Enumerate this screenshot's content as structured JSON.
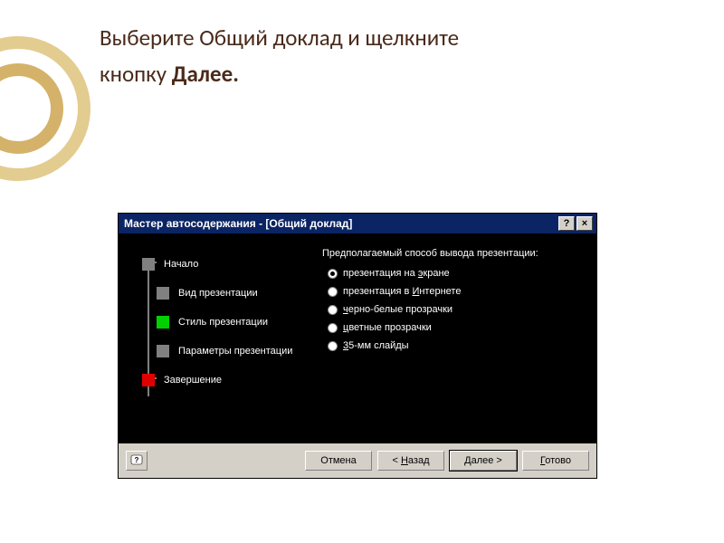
{
  "instruction": {
    "line1": "Выберите Общий доклад и щелкните",
    "line2_prefix": "кнопку ",
    "line2_bold": "Далее."
  },
  "dialog": {
    "title": "Мастер автосодержания - [Общий доклад]",
    "steps": [
      {
        "label": "Начало",
        "color": "gray",
        "offset": false
      },
      {
        "label": "Вид презентации",
        "color": "gray",
        "offset": true
      },
      {
        "label": "Стиль презентации",
        "color": "green",
        "offset": true
      },
      {
        "label": "Параметры презентации",
        "color": "gray",
        "offset": true
      },
      {
        "label": "Завершение",
        "color": "red",
        "offset": false
      }
    ],
    "options_header": "Предполагаемый способ вывода презентации:",
    "options": [
      {
        "label_pre": "презентация на ",
        "ul": "э",
        "label_post": "кране",
        "selected": true
      },
      {
        "label_pre": "презентация в ",
        "ul": "И",
        "label_post": "нтернете",
        "selected": false
      },
      {
        "label_pre": "",
        "ul": "ч",
        "label_post": "ерно-белые прозрачки",
        "selected": false
      },
      {
        "label_pre": "",
        "ul": "ц",
        "label_post": "ветные прозрачки",
        "selected": false
      },
      {
        "label_pre": "",
        "ul": "3",
        "label_post": "5-мм слайды",
        "selected": false
      }
    ],
    "buttons": {
      "cancel": "Отмена",
      "back_pre": "< ",
      "back_ul": "Н",
      "back_post": "азад",
      "next_ul": "Д",
      "next_post": "алее >",
      "finish_ul": "Г",
      "finish_post": "отово"
    },
    "help_icon": "?",
    "close_icon": "×"
  }
}
